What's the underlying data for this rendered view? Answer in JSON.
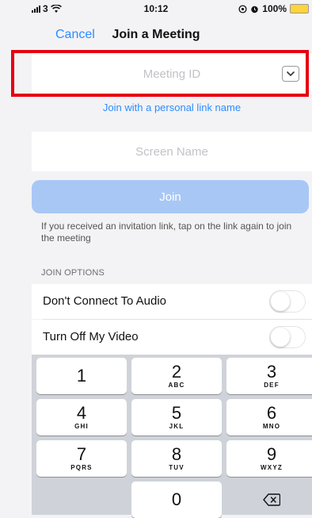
{
  "status_bar": {
    "carrier": "3",
    "time": "10:12",
    "battery": "100%"
  },
  "nav": {
    "cancel_label": "Cancel",
    "title": "Join a Meeting"
  },
  "meeting_id": {
    "placeholder": "Meeting ID",
    "value": ""
  },
  "personal_link_label": "Join with a personal link name",
  "screen_name": {
    "placeholder": "Screen Name",
    "value": ""
  },
  "join_label": "Join",
  "hint_text": "If you received an invitation link, tap on the link again to join the meeting",
  "join_options": {
    "header": "JOIN OPTIONS",
    "items": [
      {
        "label": "Don't Connect To Audio",
        "enabled": false
      },
      {
        "label": "Turn Off My Video",
        "enabled": false
      }
    ]
  },
  "keyboard": {
    "keys": [
      {
        "num": "1",
        "letters": ""
      },
      {
        "num": "2",
        "letters": "ABC"
      },
      {
        "num": "3",
        "letters": "DEF"
      },
      {
        "num": "4",
        "letters": "GHI"
      },
      {
        "num": "5",
        "letters": "JKL"
      },
      {
        "num": "6",
        "letters": "MNO"
      },
      {
        "num": "7",
        "letters": "PQRS"
      },
      {
        "num": "8",
        "letters": "TUV"
      },
      {
        "num": "9",
        "letters": "WXYZ"
      },
      {
        "num": "0",
        "letters": ""
      }
    ]
  },
  "colors": {
    "accent": "#2d8cff",
    "join_disabled": "#a9c7f5",
    "highlight": "#e60012",
    "battery": "#ffd43b"
  }
}
